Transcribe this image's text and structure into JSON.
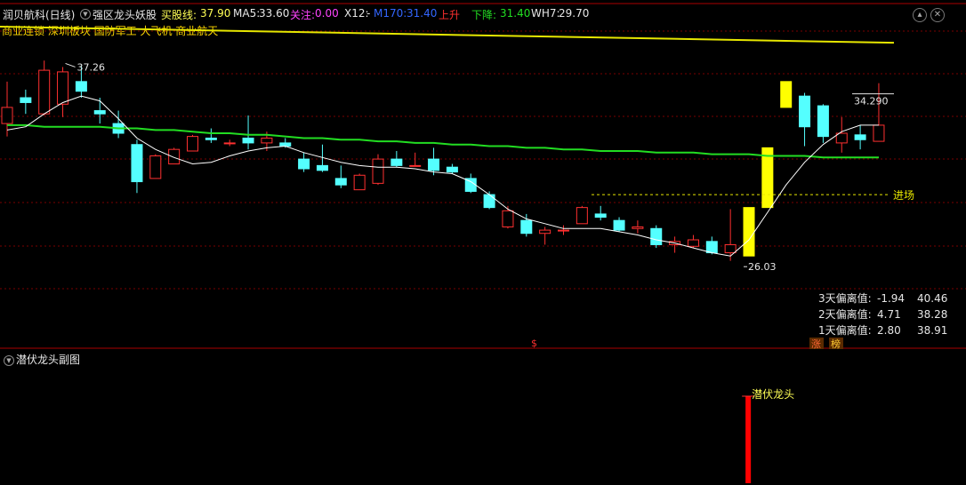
{
  "header": {
    "stock": "润贝航科(日线)",
    "indicator": "强区龙头妖股",
    "buyline_label": "买股线:",
    "buyline_value": "37.90",
    "ma5_label": "MA5:",
    "ma5_value": "33.60",
    "watch_label": "关注:",
    "watch_value": "0.00",
    "x12_label": "X12:",
    "x12_value": "-",
    "m170_label": "M170:",
    "m170_value": "31.40",
    "up_label": "上升",
    "down_label": "下降:",
    "down_value": "31.40",
    "wh7_label": "WH7:",
    "wh7_value": "29.70"
  },
  "tags": "商业连锁 深圳板块 国防军工 大飞机 商业航天",
  "annotations": {
    "high_label": "37.26",
    "low_label": "26.03",
    "last_label": "34.290",
    "entry_label": "进场",
    "dollar_mark": "$"
  },
  "stats": [
    {
      "label": "3天偏离值:",
      "value": "-1.94",
      "extra": "40.46"
    },
    {
      "label": "2天偏离值:",
      "value": "4.71",
      "extra": "38.28"
    },
    {
      "label": "1天偏离值:",
      "value": "2.80",
      "extra": "38.91"
    }
  ],
  "badges": [
    "涨",
    "榜"
  ],
  "subchart": {
    "title": "潜伏龙头副图",
    "signal_label": "潜伏龙头"
  },
  "colors": {
    "up": "#ff3030",
    "down": "#54ffff",
    "signal": "#ffff00",
    "ma_long": "#22dd22",
    "ma_short": "#ffffff",
    "buyline": "#e6e600",
    "grid": "#7a0000"
  },
  "chart_data": {
    "type": "candlestick",
    "price_range": [
      23.5,
      40.0
    ],
    "candles": [
      {
        "o": 34.0,
        "h": 36.6,
        "l": 33.2,
        "c": 35.0,
        "color": "up"
      },
      {
        "o": 35.3,
        "h": 36.1,
        "l": 34.6,
        "c": 35.6,
        "color": "down"
      },
      {
        "o": 34.6,
        "h": 37.9,
        "l": 34.5,
        "c": 37.3,
        "color": "up"
      },
      {
        "o": 35.2,
        "h": 37.5,
        "l": 34.4,
        "c": 37.2,
        "color": "up"
      },
      {
        "o": 36.6,
        "h": 37.6,
        "l": 35.6,
        "c": 36.0,
        "color": "down"
      },
      {
        "o": 34.8,
        "h": 35.6,
        "l": 34.0,
        "c": 34.6,
        "color": "down"
      },
      {
        "o": 34.0,
        "h": 34.8,
        "l": 33.1,
        "c": 33.4,
        "color": "down"
      },
      {
        "o": 32.7,
        "h": 33.0,
        "l": 29.7,
        "c": 30.4,
        "color": "down"
      },
      {
        "o": 30.6,
        "h": 32.1,
        "l": 30.6,
        "c": 32.0,
        "color": "up"
      },
      {
        "o": 31.5,
        "h": 32.5,
        "l": 31.5,
        "c": 32.4,
        "color": "up"
      },
      {
        "o": 32.3,
        "h": 33.3,
        "l": 32.3,
        "c": 33.2,
        "color": "up"
      },
      {
        "o": 33.1,
        "h": 33.7,
        "l": 32.8,
        "c": 33.0,
        "color": "down"
      },
      {
        "o": 32.8,
        "h": 33.0,
        "l": 32.6,
        "c": 32.8,
        "color": "up"
      },
      {
        "o": 33.1,
        "h": 34.5,
        "l": 32.4,
        "c": 32.8,
        "color": "down"
      },
      {
        "o": 33.1,
        "h": 33.5,
        "l": 32.3,
        "c": 32.8,
        "color": "up"
      },
      {
        "o": 32.8,
        "h": 33.1,
        "l": 32.5,
        "c": 32.6,
        "color": "down"
      },
      {
        "o": 31.8,
        "h": 32.2,
        "l": 31.0,
        "c": 31.2,
        "color": "down"
      },
      {
        "o": 31.4,
        "h": 32.7,
        "l": 31.0,
        "c": 31.1,
        "color": "down"
      },
      {
        "o": 30.6,
        "h": 31.4,
        "l": 30.0,
        "c": 30.2,
        "color": "down"
      },
      {
        "o": 29.9,
        "h": 30.9,
        "l": 29.9,
        "c": 30.8,
        "color": "up"
      },
      {
        "o": 30.3,
        "h": 32.1,
        "l": 30.2,
        "c": 31.8,
        "color": "up"
      },
      {
        "o": 31.4,
        "h": 32.3,
        "l": 31.3,
        "c": 31.8,
        "color": "down"
      },
      {
        "o": 31.4,
        "h": 32.2,
        "l": 31.4,
        "c": 31.4,
        "color": "up"
      },
      {
        "o": 31.8,
        "h": 32.5,
        "l": 30.8,
        "c": 31.1,
        "color": "down"
      },
      {
        "o": 31.3,
        "h": 31.5,
        "l": 30.9,
        "c": 31.0,
        "color": "down"
      },
      {
        "o": 30.6,
        "h": 30.9,
        "l": 29.7,
        "c": 29.8,
        "color": "down"
      },
      {
        "o": 29.6,
        "h": 29.8,
        "l": 28.7,
        "c": 28.8,
        "color": "down"
      },
      {
        "o": 28.6,
        "h": 28.9,
        "l": 27.5,
        "c": 27.6,
        "color": "up"
      },
      {
        "o": 28.0,
        "h": 28.4,
        "l": 27.0,
        "c": 27.2,
        "color": "down"
      },
      {
        "o": 27.4,
        "h": 27.6,
        "l": 26.5,
        "c": 27.2,
        "color": "up"
      },
      {
        "o": 27.4,
        "h": 27.7,
        "l": 27.1,
        "c": 27.4,
        "color": "up"
      },
      {
        "o": 27.8,
        "h": 28.9,
        "l": 27.8,
        "c": 28.8,
        "color": "up"
      },
      {
        "o": 28.4,
        "h": 28.9,
        "l": 28.0,
        "c": 28.2,
        "color": "down"
      },
      {
        "o": 28.0,
        "h": 28.2,
        "l": 27.3,
        "c": 27.4,
        "color": "down"
      },
      {
        "o": 27.6,
        "h": 28.0,
        "l": 27.2,
        "c": 27.5,
        "color": "up"
      },
      {
        "o": 27.5,
        "h": 27.7,
        "l": 26.3,
        "c": 26.5,
        "color": "down"
      },
      {
        "o": 26.5,
        "h": 27.0,
        "l": 26.0,
        "c": 26.7,
        "color": "up"
      },
      {
        "o": 26.8,
        "h": 27.1,
        "l": 26.3,
        "c": 26.4,
        "color": "up"
      },
      {
        "o": 26.7,
        "h": 27.0,
        "l": 25.9,
        "c": 26.0,
        "color": "down"
      },
      {
        "o": 26.0,
        "h": 28.7,
        "l": 25.5,
        "c": 26.5,
        "color": "up"
      },
      {
        "o": 25.8,
        "h": 28.8,
        "l": 25.8,
        "c": 28.8,
        "color": "signal"
      },
      {
        "o": 28.8,
        "h": 32.5,
        "l": 28.8,
        "c": 32.5,
        "color": "signal"
      },
      {
        "o": 35.0,
        "h": 36.6,
        "l": 35.0,
        "c": 36.6,
        "color": "signal"
      },
      {
        "o": 35.7,
        "h": 35.9,
        "l": 32.6,
        "c": 33.8,
        "color": "down"
      },
      {
        "o": 35.1,
        "h": 35.2,
        "l": 32.8,
        "c": 33.2,
        "color": "down"
      },
      {
        "o": 32.8,
        "h": 34.4,
        "l": 32.2,
        "c": 33.4,
        "color": "up"
      },
      {
        "o": 33.3,
        "h": 33.9,
        "l": 32.4,
        "c": 33.0,
        "color": "down"
      },
      {
        "o": 32.9,
        "h": 36.5,
        "l": 32.9,
        "c": 33.9,
        "color": "up"
      }
    ],
    "ma_short": [
      33.6,
      33.8,
      34.6,
      35.3,
      35.7,
      35.4,
      34.3,
      33.1,
      32.4,
      31.9,
      31.5,
      31.6,
      32.0,
      32.3,
      32.5,
      32.6,
      32.2,
      31.9,
      31.6,
      31.4,
      31.3,
      31.3,
      31.2,
      31.0,
      30.9,
      30.4,
      29.6,
      28.7,
      28.1,
      27.8,
      27.5,
      27.5,
      27.5,
      27.3,
      27.1,
      26.8,
      26.6,
      26.3,
      26.0,
      25.8,
      26.8,
      28.5,
      30.2,
      31.6,
      32.7,
      33.5,
      33.9,
      33.9
    ],
    "ma_long": [
      33.9,
      33.9,
      33.8,
      33.8,
      33.8,
      33.8,
      33.7,
      33.7,
      33.6,
      33.6,
      33.5,
      33.4,
      33.4,
      33.3,
      33.3,
      33.2,
      33.1,
      33.1,
      33.0,
      33.0,
      32.9,
      32.9,
      32.8,
      32.8,
      32.7,
      32.7,
      32.6,
      32.6,
      32.5,
      32.5,
      32.4,
      32.4,
      32.3,
      32.3,
      32.3,
      32.2,
      32.2,
      32.2,
      32.1,
      32.1,
      32.1,
      32.0,
      32.0,
      32.0,
      31.9,
      31.9,
      31.9,
      31.9
    ],
    "buyline": [
      40.0,
      39.0
    ],
    "entry_level": 29.6,
    "sub_signal": [
      {
        "index": 39,
        "value": 1
      }
    ]
  }
}
